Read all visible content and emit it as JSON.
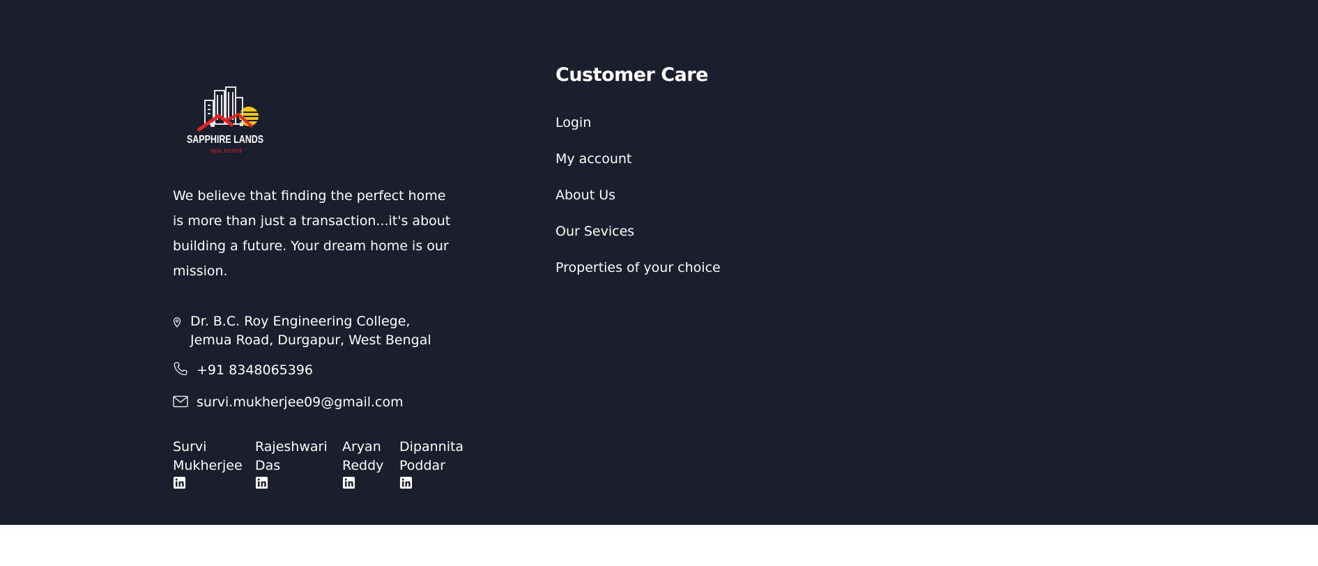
{
  "brand": {
    "logo_text": "SAPPHIRE LANDS",
    "logo_subtext": "REAL ESTATE"
  },
  "about": {
    "lines": [
      "We believe that finding the perfect home",
      "is more than just a transaction...it's about",
      "building a future. Your dream home is our",
      "mission."
    ]
  },
  "contact": {
    "address_line1": "Dr. B.C. Roy Engineering College,",
    "address_line2": "Jemua Road, Durgapur, West Bengal",
    "phone": "+91 8348065396",
    "email": "survi.mukherjee09@gmail.com",
    "icons": [
      "map-pin-icon",
      "phone-icon",
      "mail-icon"
    ]
  },
  "team": [
    {
      "first": "Survi",
      "last": "Mukherjee",
      "icon": "linkedin-icon"
    },
    {
      "first": "Rajeshwari",
      "last": "Das",
      "icon": "linkedin-icon"
    },
    {
      "first": "Aryan",
      "last": "Reddy",
      "icon": "linkedin-icon"
    },
    {
      "first": "Dipannita",
      "last": "Poddar",
      "icon": "linkedin-icon"
    }
  ],
  "customer_care": {
    "title": "Customer Care",
    "links": [
      "Login",
      "My account",
      "About Us",
      "Our Sevices",
      "Properties of your choice"
    ]
  },
  "colors": {
    "footer_bg": "#1b1e2c",
    "text": "#ffffff",
    "logo_red": "#e02424",
    "logo_sun": "#f5c518"
  }
}
